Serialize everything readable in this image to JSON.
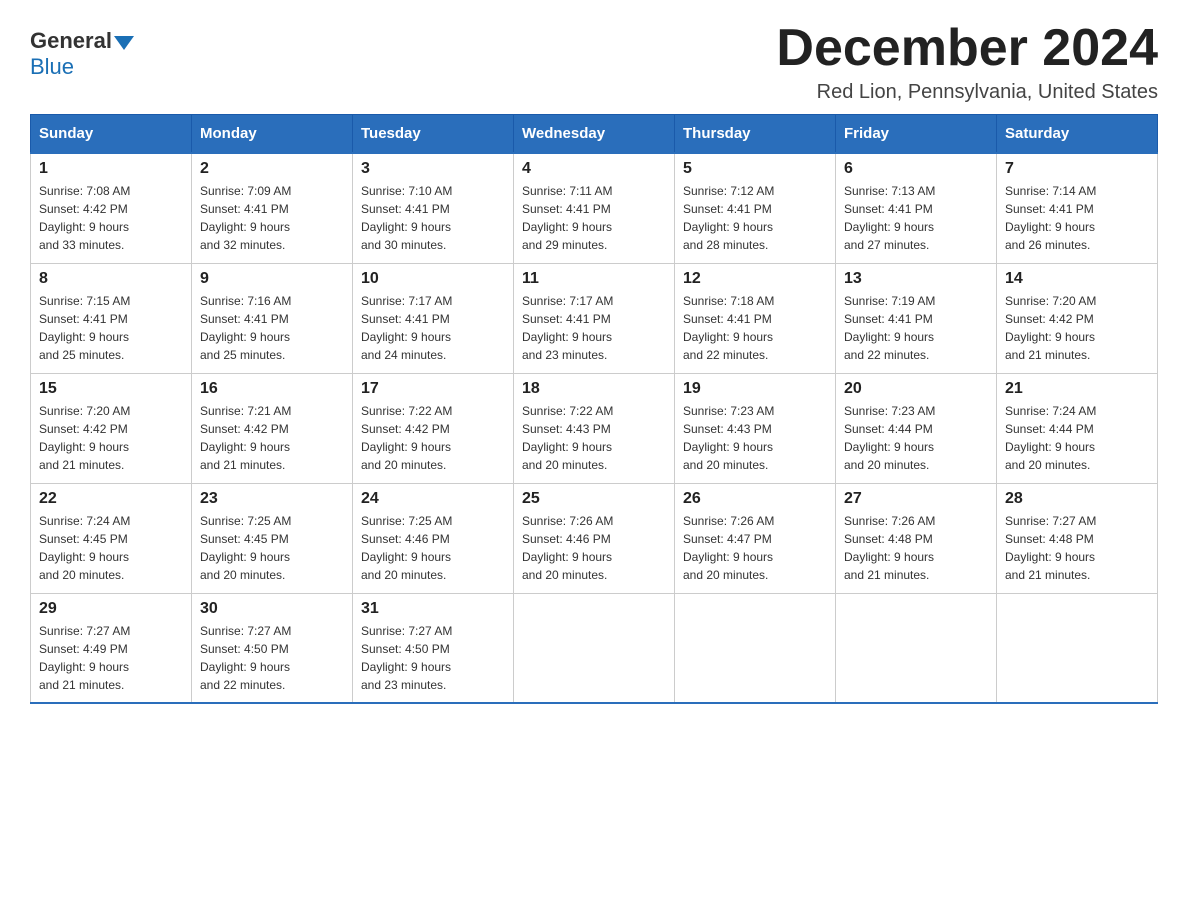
{
  "logo": {
    "general": "General",
    "blue": "Blue"
  },
  "title": "December 2024",
  "location": "Red Lion, Pennsylvania, United States",
  "headers": [
    "Sunday",
    "Monday",
    "Tuesday",
    "Wednesday",
    "Thursday",
    "Friday",
    "Saturday"
  ],
  "weeks": [
    [
      {
        "day": "1",
        "sunrise": "7:08 AM",
        "sunset": "4:42 PM",
        "daylight": "9 hours and 33 minutes."
      },
      {
        "day": "2",
        "sunrise": "7:09 AM",
        "sunset": "4:41 PM",
        "daylight": "9 hours and 32 minutes."
      },
      {
        "day": "3",
        "sunrise": "7:10 AM",
        "sunset": "4:41 PM",
        "daylight": "9 hours and 30 minutes."
      },
      {
        "day": "4",
        "sunrise": "7:11 AM",
        "sunset": "4:41 PM",
        "daylight": "9 hours and 29 minutes."
      },
      {
        "day": "5",
        "sunrise": "7:12 AM",
        "sunset": "4:41 PM",
        "daylight": "9 hours and 28 minutes."
      },
      {
        "day": "6",
        "sunrise": "7:13 AM",
        "sunset": "4:41 PM",
        "daylight": "9 hours and 27 minutes."
      },
      {
        "day": "7",
        "sunrise": "7:14 AM",
        "sunset": "4:41 PM",
        "daylight": "9 hours and 26 minutes."
      }
    ],
    [
      {
        "day": "8",
        "sunrise": "7:15 AM",
        "sunset": "4:41 PM",
        "daylight": "9 hours and 25 minutes."
      },
      {
        "day": "9",
        "sunrise": "7:16 AM",
        "sunset": "4:41 PM",
        "daylight": "9 hours and 25 minutes."
      },
      {
        "day": "10",
        "sunrise": "7:17 AM",
        "sunset": "4:41 PM",
        "daylight": "9 hours and 24 minutes."
      },
      {
        "day": "11",
        "sunrise": "7:17 AM",
        "sunset": "4:41 PM",
        "daylight": "9 hours and 23 minutes."
      },
      {
        "day": "12",
        "sunrise": "7:18 AM",
        "sunset": "4:41 PM",
        "daylight": "9 hours and 22 minutes."
      },
      {
        "day": "13",
        "sunrise": "7:19 AM",
        "sunset": "4:41 PM",
        "daylight": "9 hours and 22 minutes."
      },
      {
        "day": "14",
        "sunrise": "7:20 AM",
        "sunset": "4:42 PM",
        "daylight": "9 hours and 21 minutes."
      }
    ],
    [
      {
        "day": "15",
        "sunrise": "7:20 AM",
        "sunset": "4:42 PM",
        "daylight": "9 hours and 21 minutes."
      },
      {
        "day": "16",
        "sunrise": "7:21 AM",
        "sunset": "4:42 PM",
        "daylight": "9 hours and 21 minutes."
      },
      {
        "day": "17",
        "sunrise": "7:22 AM",
        "sunset": "4:42 PM",
        "daylight": "9 hours and 20 minutes."
      },
      {
        "day": "18",
        "sunrise": "7:22 AM",
        "sunset": "4:43 PM",
        "daylight": "9 hours and 20 minutes."
      },
      {
        "day": "19",
        "sunrise": "7:23 AM",
        "sunset": "4:43 PM",
        "daylight": "9 hours and 20 minutes."
      },
      {
        "day": "20",
        "sunrise": "7:23 AM",
        "sunset": "4:44 PM",
        "daylight": "9 hours and 20 minutes."
      },
      {
        "day": "21",
        "sunrise": "7:24 AM",
        "sunset": "4:44 PM",
        "daylight": "9 hours and 20 minutes."
      }
    ],
    [
      {
        "day": "22",
        "sunrise": "7:24 AM",
        "sunset": "4:45 PM",
        "daylight": "9 hours and 20 minutes."
      },
      {
        "day": "23",
        "sunrise": "7:25 AM",
        "sunset": "4:45 PM",
        "daylight": "9 hours and 20 minutes."
      },
      {
        "day": "24",
        "sunrise": "7:25 AM",
        "sunset": "4:46 PM",
        "daylight": "9 hours and 20 minutes."
      },
      {
        "day": "25",
        "sunrise": "7:26 AM",
        "sunset": "4:46 PM",
        "daylight": "9 hours and 20 minutes."
      },
      {
        "day": "26",
        "sunrise": "7:26 AM",
        "sunset": "4:47 PM",
        "daylight": "9 hours and 20 minutes."
      },
      {
        "day": "27",
        "sunrise": "7:26 AM",
        "sunset": "4:48 PM",
        "daylight": "9 hours and 21 minutes."
      },
      {
        "day": "28",
        "sunrise": "7:27 AM",
        "sunset": "4:48 PM",
        "daylight": "9 hours and 21 minutes."
      }
    ],
    [
      {
        "day": "29",
        "sunrise": "7:27 AM",
        "sunset": "4:49 PM",
        "daylight": "9 hours and 21 minutes."
      },
      {
        "day": "30",
        "sunrise": "7:27 AM",
        "sunset": "4:50 PM",
        "daylight": "9 hours and 22 minutes."
      },
      {
        "day": "31",
        "sunrise": "7:27 AM",
        "sunset": "4:50 PM",
        "daylight": "9 hours and 23 minutes."
      },
      null,
      null,
      null,
      null
    ]
  ],
  "labels": {
    "sunrise": "Sunrise:",
    "sunset": "Sunset:",
    "daylight": "Daylight:"
  }
}
